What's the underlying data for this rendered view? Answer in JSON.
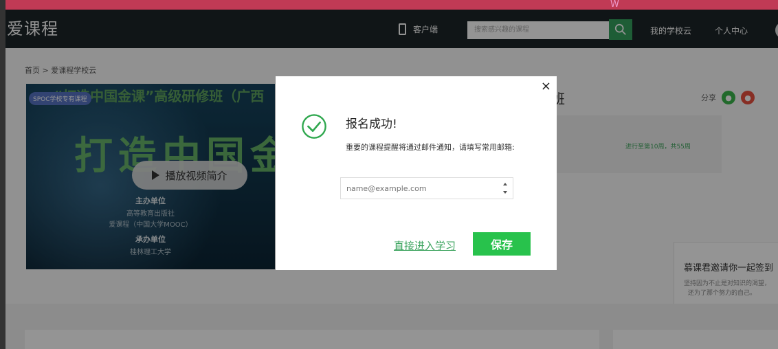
{
  "header": {
    "logo": "爱课程",
    "client_label": "客户端",
    "search_placeholder": "搜索感兴趣的课程",
    "my_school": "我的学校云",
    "personal_center": "个人中心"
  },
  "breadcrumb": "首页 > 爱课程学校云",
  "course": {
    "badge": "SPOC学校专有课程",
    "banner_title": "“打造中国金课”高级研修班（广西",
    "banner_big": "打造中国金",
    "play_label": "播放视频简介",
    "organizer_heading": "主办单位",
    "organizer_1": "高等教育出版社",
    "organizer_2": "爱课程（中国大学MOOC）",
    "host_heading": "承办单位",
    "host_1": "桂林理工大学",
    "title_tail": "班",
    "progress": "进行至第10周，共55周",
    "share_label": "分享"
  },
  "invite": {
    "title": "慕课君邀请你一起签到",
    "line1": "坚持因为不止是对知识的渴望，",
    "line2": "还为了那个努力的自己。"
  },
  "modal": {
    "title": "报名成功!",
    "message": "重要的课程提醒将通过邮件通知，请填写常用邮箱:",
    "email_placeholder": "name@example.com",
    "direct_link": "直接进入学习",
    "save_label": "保存",
    "close_glyph": "×"
  },
  "colors": {
    "header_bg": "#1d2528",
    "accent_green": "#28c24c",
    "link_green": "#3aa35d",
    "check_green": "#30a84f"
  }
}
